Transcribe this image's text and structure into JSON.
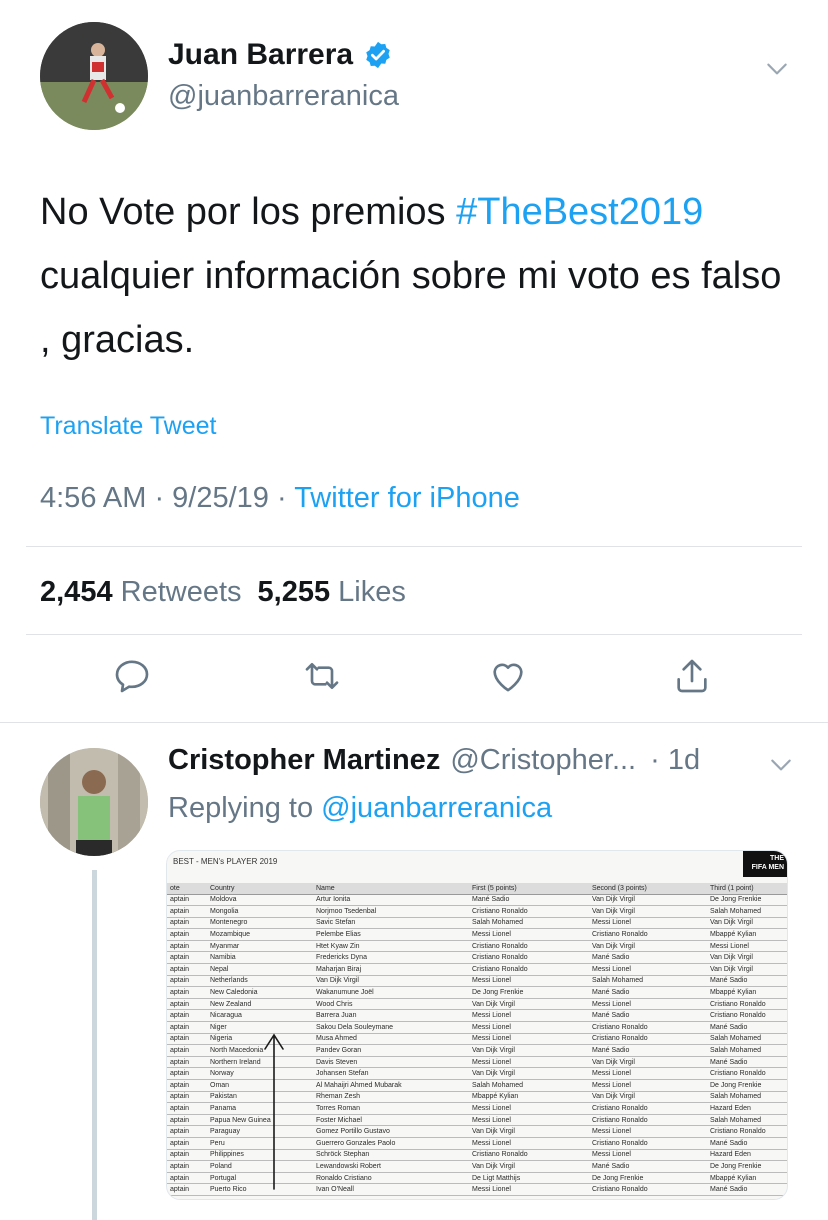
{
  "tweet": {
    "author_name": "Juan Barrera",
    "author_handle": "@juanbarreranica",
    "text_before": "No Vote por los premios ",
    "hashtag": "#TheBest2019",
    "text_after": " cualquier información sobre mi voto es falso , gracias.",
    "translate_label": "Translate Tweet",
    "time": "4:56 AM · 9/25/19 · ",
    "source": "Twitter for iPhone",
    "retweets_count": "2,454",
    "retweets_label": "Retweets",
    "likes_count": "5,255",
    "likes_label": "Likes"
  },
  "actions": [
    "reply-icon",
    "retweet-icon",
    "like-icon",
    "share-icon"
  ],
  "reply": {
    "author_name": "Cristopher Martinez",
    "author_handle": "@Cristopher...",
    "time": "· 1d",
    "replying_prefix": "Replying to ",
    "replying_mention": "@juanbarreranica"
  },
  "attached_image": {
    "title": "BEST - MEN's PLAYER 2019",
    "logo_text_1": "THE",
    "logo_text_2": "FIFA MEN",
    "headers": [
      "ote",
      "Country",
      "Name",
      "First (5 points)",
      "Second (3 points)",
      "Third (1 point)"
    ],
    "rows": [
      [
        "aptain",
        "Moldova",
        "Artur Ionita",
        "Mané Sadio",
        "Van Dijk Virgil",
        "De Jong Frenkie"
      ],
      [
        "aptain",
        "Mongolia",
        "Norjmoo Tsedenbal",
        "Cristiano Ronaldo",
        "Van Dijk Virgil",
        "Salah Mohamed"
      ],
      [
        "aptain",
        "Montenegro",
        "Savic Stefan",
        "Salah Mohamed",
        "Messi Lionel",
        "Van Dijk Virgil"
      ],
      [
        "aptain",
        "Mozambique",
        "Pelembe Elias",
        "Messi Lionel",
        "Cristiano Ronaldo",
        "Mbappé Kylian"
      ],
      [
        "aptain",
        "Myanmar",
        "Htet Kyaw Zin",
        "Cristiano Ronaldo",
        "Van Dijk Virgil",
        "Messi Lionel"
      ],
      [
        "aptain",
        "Namibia",
        "Fredericks Dyna",
        "Cristiano Ronaldo",
        "Mané Sadio",
        "Van Dijk Virgil"
      ],
      [
        "aptain",
        "Nepal",
        "Maharjan Biraj",
        "Cristiano Ronaldo",
        "Messi Lionel",
        "Van Dijk Virgil"
      ],
      [
        "aptain",
        "Netherlands",
        "Van Dijk Virgil",
        "Messi Lionel",
        "Salah Mohamed",
        "Mané Sadio"
      ],
      [
        "aptain",
        "New Caledonia",
        "Wakanumune Joël",
        "De Jong Frenkie",
        "Mané Sadio",
        "Mbappé Kylian"
      ],
      [
        "aptain",
        "New Zealand",
        "Wood Chris",
        "Van Dijk Virgil",
        "Messi Lionel",
        "Cristiano Ronaldo"
      ],
      [
        "aptain",
        "Nicaragua",
        "Barrera Juan",
        "Messi Lionel",
        "Mané Sadio",
        "Cristiano Ronaldo"
      ],
      [
        "aptain",
        "Niger",
        "Sakou Dela Souleymane",
        "Messi Lionel",
        "Cristiano Ronaldo",
        "Mané Sadio"
      ],
      [
        "aptain",
        "Nigeria",
        "Musa Ahmed",
        "Messi Lionel",
        "Cristiano Ronaldo",
        "Salah Mohamed"
      ],
      [
        "aptain",
        "North Macedonia",
        "Pandev Goran",
        "Van Dijk Virgil",
        "Mané Sadio",
        "Salah Mohamed"
      ],
      [
        "aptain",
        "Northern Ireland",
        "Davis Steven",
        "Messi Lionel",
        "Van Dijk Virgil",
        "Mané Sadio"
      ],
      [
        "aptain",
        "Norway",
        "Johansen Stefan",
        "Van Dijk Virgil",
        "Messi Lionel",
        "Cristiano Ronaldo"
      ],
      [
        "aptain",
        "Oman",
        "Al Mahaijri Ahmed Mubarak",
        "Salah Mohamed",
        "Messi Lionel",
        "De Jong Frenkie"
      ],
      [
        "aptain",
        "Pakistan",
        "Rheman Zesh",
        "Mbappé Kylian",
        "Van Dijk Virgil",
        "Salah Mohamed"
      ],
      [
        "aptain",
        "Panama",
        "Torres Roman",
        "Messi Lionel",
        "Cristiano Ronaldo",
        "Hazard Eden"
      ],
      [
        "aptain",
        "Papua New Guinea",
        "Foster Michael",
        "Messi Lionel",
        "Cristiano Ronaldo",
        "Salah Mohamed"
      ],
      [
        "aptain",
        "Paraguay",
        "Gomez Portillo Gustavo",
        "Van Dijk Virgil",
        "Messi Lionel",
        "Cristiano Ronaldo"
      ],
      [
        "aptain",
        "Peru",
        "Guerrero Gonzales Paolo",
        "Messi Lionel",
        "Cristiano Ronaldo",
        "Mané Sadio"
      ],
      [
        "aptain",
        "Philippines",
        "Schröck Stephan",
        "Cristiano Ronaldo",
        "Messi Lionel",
        "Hazard Eden"
      ],
      [
        "aptain",
        "Poland",
        "Lewandowski Robert",
        "Van Dijk Virgil",
        "Mané Sadio",
        "De Jong Frenkie"
      ],
      [
        "aptain",
        "Portugal",
        "Ronaldo Cristiano",
        "De Ligt Matthijs",
        "De Jong Frenkie",
        "Mbappé Kylian"
      ],
      [
        "aptain",
        "Puerto Rico",
        "Ivan O'Neall",
        "Messi Lionel",
        "Cristiano Ronaldo",
        "Mané Sadio"
      ]
    ]
  },
  "colors": {
    "link_blue": "#1da1f2",
    "secondary_text": "#657786",
    "primary_text": "#14171a",
    "divider": "#dfe3e8"
  }
}
